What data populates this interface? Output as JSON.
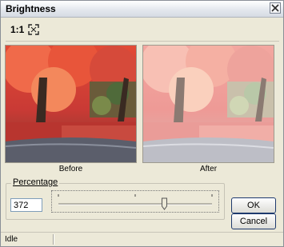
{
  "dialog": {
    "title": "Brightness"
  },
  "toolbar": {
    "zoom_actual_label": "1:1",
    "zoom_fit_icon": "fit-to-window-icon"
  },
  "preview": {
    "before_caption": "Before",
    "after_caption": "After"
  },
  "percentage": {
    "group_label": "Percentage",
    "value": "372",
    "slider_level_fraction": 0.69
  },
  "buttons": {
    "ok_label": "OK",
    "cancel_label": "Cancel"
  },
  "status": {
    "text": "Idle"
  },
  "colors": {
    "accent": "#1e3a6e",
    "face": "#ece9d8"
  }
}
